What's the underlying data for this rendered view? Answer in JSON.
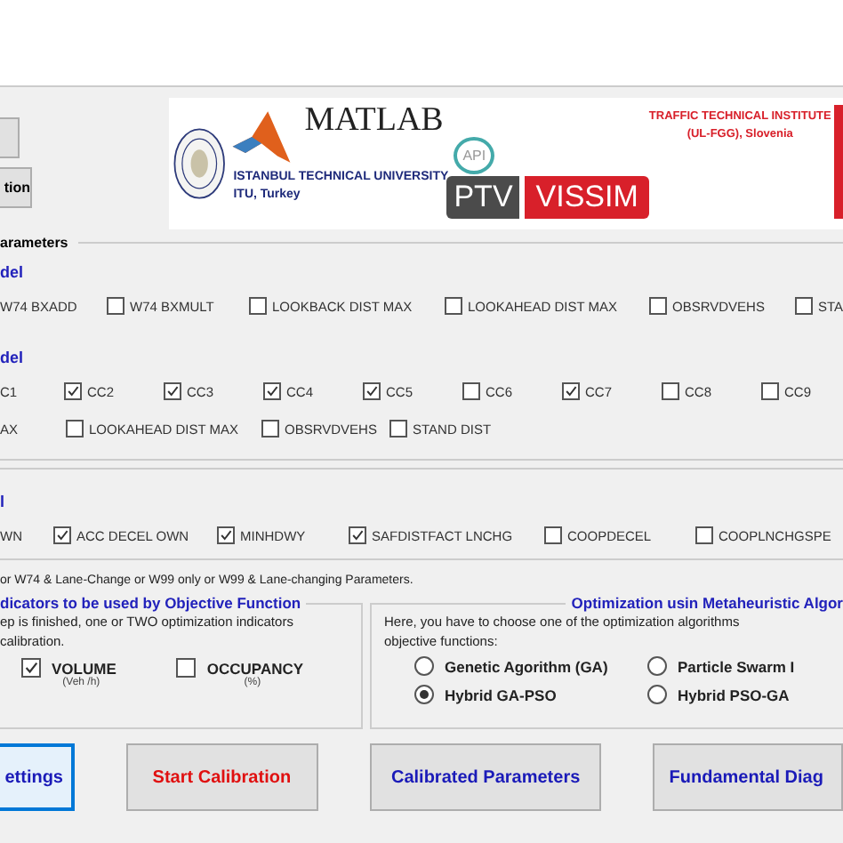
{
  "top_buttons": [
    {
      "kind": "blank"
    },
    {
      "kind": "text",
      "label": "tion"
    }
  ],
  "banner": {
    "matlab": "MATLAB",
    "api": "API",
    "university": "ISTANBUL TECHNICAL UNIVERSITY",
    "university_place": "ITU, Turkey",
    "ptv": "PTV",
    "vissim": "VISSIM",
    "institute": "TRAFFIC TECHNICAL INSTITUTE",
    "institute_place": "(UL-FGG), Slovenia"
  },
  "section_title": "arameters",
  "groups": [
    {
      "title": "del",
      "lines": [
        [
          {
            "kind": "label",
            "label": "W74 BXADD"
          },
          {
            "kind": "checkbox",
            "label": "W74 BXMULT",
            "checked": false
          },
          {
            "kind": "checkbox",
            "label": "LOOKBACK DIST MAX",
            "checked": false
          },
          {
            "kind": "checkbox",
            "label": "LOOKAHEAD DIST MAX",
            "checked": false
          },
          {
            "kind": "checkbox",
            "label": "OBSRVDVEHS",
            "checked": false
          },
          {
            "kind": "checkbox",
            "label": "STA",
            "checked": false
          }
        ]
      ]
    },
    {
      "title": "del",
      "lines": [
        [
          {
            "kind": "label",
            "label": "C1"
          },
          {
            "kind": "checkbox",
            "label": "CC2",
            "checked": true
          },
          {
            "kind": "checkbox",
            "label": "CC3",
            "checked": true
          },
          {
            "kind": "checkbox",
            "label": "CC4",
            "checked": true
          },
          {
            "kind": "checkbox",
            "label": "CC5",
            "checked": true
          },
          {
            "kind": "checkbox",
            "label": "CC6",
            "checked": false
          },
          {
            "kind": "checkbox",
            "label": "CC7",
            "checked": true
          },
          {
            "kind": "checkbox",
            "label": "CC8",
            "checked": false
          },
          {
            "kind": "checkbox",
            "label": "CC9",
            "checked": false
          }
        ],
        [
          {
            "kind": "label",
            "label": "AX"
          },
          {
            "kind": "checkbox",
            "label": "LOOKAHEAD DIST MAX",
            "checked": false
          },
          {
            "kind": "checkbox",
            "label": "OBSRVDVEHS",
            "checked": false
          },
          {
            "kind": "checkbox",
            "label": "STAND DIST",
            "checked": false
          }
        ]
      ]
    },
    {
      "title": "l",
      "lines": [
        [
          {
            "kind": "label",
            "label": "WN"
          },
          {
            "kind": "checkbox",
            "label": "ACC DECEL OWN",
            "checked": true
          },
          {
            "kind": "checkbox",
            "label": "MINHDWY",
            "checked": true
          },
          {
            "kind": "checkbox",
            "label": "SAFDISTFACT LNCHG",
            "checked": true
          },
          {
            "kind": "checkbox",
            "label": "COOPDECEL",
            "checked": false
          },
          {
            "kind": "checkbox",
            "label": "COOPLNCHGSPE",
            "checked": false
          }
        ]
      ]
    }
  ],
  "note": "or W74 & Lane-Change or W99 only or W99 & Lane-changing Parameters.",
  "indicators": {
    "title": "dicators to be used by Objective Function",
    "text": [
      "ep is finished, one or TWO optimization indicators",
      "calibration."
    ],
    "options": [
      {
        "label": "VOLUME",
        "unit": "(Veh /h)",
        "checked": true
      },
      {
        "label": "OCCUPANCY",
        "unit": "(%)",
        "checked": false
      }
    ]
  },
  "optimization": {
    "title": "Optimization usin Metaheuristic Algor",
    "text": [
      "Here, you have to choose one of the optimization algorithms",
      "objective functions:"
    ],
    "options": [
      {
        "label": "Genetic Agorithm (GA)",
        "selected": false
      },
      {
        "label": "Particle Swarm I",
        "selected": false
      },
      {
        "label": "Hybrid GA-PSO",
        "selected": true
      },
      {
        "label": "Hybrid PSO-GA",
        "selected": false
      }
    ]
  },
  "buttons": [
    {
      "label": "ettings",
      "kind": "focused"
    },
    {
      "label": "Start Calibration",
      "kind": "danger"
    },
    {
      "label": "Calibrated Parameters",
      "kind": "normal"
    },
    {
      "label": "Fundamental Diag",
      "kind": "normal"
    }
  ]
}
